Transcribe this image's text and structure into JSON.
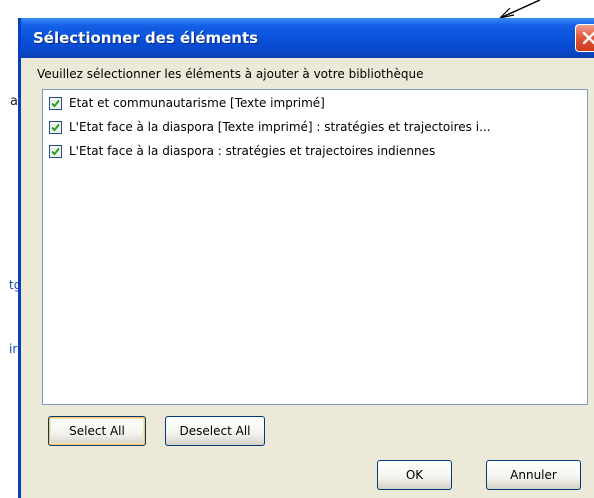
{
  "background": {
    "fragment_a": "a",
    "link_fragment_1": "tg",
    "link_fragment_2": "ir"
  },
  "dialog": {
    "title": "Sélectionner des éléments",
    "close_icon": "close-icon",
    "instruction": "Veuillez sélectionner les éléments à ajouter à votre bibliothèque",
    "items": [
      {
        "label": "Etat et communautarisme [Texte imprimé]",
        "checked": true
      },
      {
        "label": "L'Etat face à la diaspora [Texte imprimé] : stratégies et trajectoires i...",
        "checked": true
      },
      {
        "label": "L'Etat face à la diaspora : stratégies et trajectoires indiennes",
        "checked": true
      }
    ],
    "buttons": {
      "select_all": "Select All",
      "deselect_all": "Deselect All",
      "ok": "OK",
      "cancel": "Annuler"
    }
  },
  "colors": {
    "titlebar": "#0a52dc",
    "dialog_bg": "#ece9d8",
    "close_button": "#e25a3a",
    "checkmark": "#21a121"
  }
}
